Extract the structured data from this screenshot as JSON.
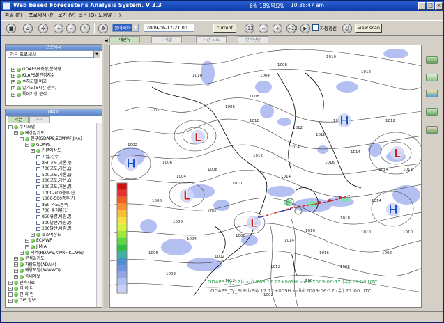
{
  "window": {
    "title": "Web based Forecaster's Analysis System. V 3.3",
    "date": "6월 18일",
    "weekday": "목요일",
    "time": "10:36:47 am",
    "controls": [
      "_",
      "□",
      "×"
    ]
  },
  "menu": [
    "파일 (F)",
    "프로세서 (P)",
    "보기 (V)",
    "옵션 (O)",
    "도움말 (H)"
  ],
  "toolbar": {
    "region_select": "동아시아",
    "datetime": "2009-06-17-21:00",
    "current_label": "current",
    "step_back12": "-12",
    "step_back": "−",
    "step_fwd": "+",
    "step_fwd12": "+12",
    "auto_label": "자동갱신",
    "view_scan_label": "view scan"
  },
  "left_top": {
    "title": "프로세서",
    "select": "기본 프로세서",
    "items": [
      "GDAPS예측장/분석장",
      "KLAPS불안정지수",
      "수치모델 비교",
      "일기도(6시간 간격)",
      "특이기상 분석"
    ]
  },
  "left_bottom": {
    "title": "데이터",
    "tabs": [
      "기본",
      "추가"
    ],
    "tree": [
      {
        "label": "수치모델",
        "indent": 0,
        "icon": "exp"
      },
      {
        "label": "예상일기도",
        "indent": 1,
        "icon": "exp"
      },
      {
        "label": "전구(GDAPS,ECMWF,JMA)",
        "indent": 2,
        "icon": "exp"
      },
      {
        "label": "GDAPS",
        "indent": 3,
        "icon": "exp"
      },
      {
        "label": "기본예상도",
        "indent": 4,
        "icon": "exp"
      },
      {
        "label": "기압,강수",
        "indent": 5,
        "icon": "cb"
      },
      {
        "label": "850고도,기온,풍",
        "indent": 5,
        "icon": "cb"
      },
      {
        "label": "700고도,기온,습",
        "indent": 5,
        "icon": "cb"
      },
      {
        "label": "500고도,기온,습",
        "indent": 5,
        "icon": "cb"
      },
      {
        "label": "300고도,기온,습",
        "indent": 5,
        "icon": "cb"
      },
      {
        "label": "200고도,기온,풍",
        "indent": 5,
        "icon": "cb"
      },
      {
        "label": "1000-700층후,습",
        "indent": 5,
        "icon": "cb"
      },
      {
        "label": "1000-500층후,기",
        "indent": 5,
        "icon": "cb"
      },
      {
        "label": "850 와도,풍속",
        "indent": 5,
        "icon": "cb"
      },
      {
        "label": "700 수직류(1)",
        "indent": 5,
        "icon": "cb"
      },
      {
        "label": "850유량,바람,풍",
        "indent": 5,
        "icon": "cb"
      },
      {
        "label": "300발산,바람,풍",
        "indent": 5,
        "icon": "cb"
      },
      {
        "label": "200발산,바람,풍",
        "indent": 5,
        "icon": "cb"
      },
      {
        "label": "보조예상도",
        "indent": 4,
        "icon": "exp"
      },
      {
        "label": "ECMWF",
        "indent": 3,
        "icon": "exp"
      },
      {
        "label": "J M A",
        "indent": 3,
        "icon": "exp"
      },
      {
        "label": "지역(RDAPS,KWRF,KLAPS)",
        "indent": 2,
        "icon": "exp"
      },
      {
        "label": "분석일기도",
        "indent": 1,
        "icon": "exp"
      },
      {
        "label": "파랑모델(ADAM)",
        "indent": 1,
        "icon": "exp"
      },
      {
        "label": "해양모델(ReWWD)",
        "indent": 1,
        "icon": "exp"
      },
      {
        "label": "동네예보",
        "indent": 1,
        "icon": "exp"
      },
      {
        "label": "관측자료",
        "indent": 0,
        "icon": "exp"
      },
      {
        "label": "레 이 더",
        "indent": 0,
        "icon": "exp"
      },
      {
        "label": "천 리 안",
        "indent": 0,
        "icon": "exp"
      },
      {
        "label": "GIS 정보",
        "indent": 0,
        "icon": "exp"
      }
    ]
  },
  "map": {
    "tabs": [
      "예만뷰",
      "시계열",
      "시간-고도",
      "연직단면"
    ],
    "pressure_labels": [
      "1010",
      "1002",
      "1006",
      "1008",
      "1004",
      "1008",
      "1010",
      "1012",
      "1002",
      "1006",
      "1004",
      "1008",
      "1010",
      "1012",
      "1014",
      "1016",
      "1018",
      "1014",
      "1012",
      "1006",
      "1010",
      "1008",
      "1004",
      "1002",
      "1006",
      "1008",
      "1012",
      "1014",
      "1010",
      "1016",
      "1018",
      "1014",
      "1012",
      "1010",
      "1008",
      "1006",
      "1004",
      "1002",
      "1010",
      "1014",
      "1012",
      "1016",
      "1014",
      "1010",
      "1008",
      "1012"
    ],
    "highs": [
      "H",
      "H",
      "H"
    ],
    "lows": [
      "L",
      "L",
      "L",
      "L"
    ],
    "caption1": "GDAPS_Ty_12(mm) IMG 17.12+009H valid 2009-06-17 (수) 21:00 UTC",
    "caption2": "GDAPS_Ty_SLP(hPa) 17.12+009H valid 2009-06-17 (수) 21:00 UTC"
  },
  "colors": {
    "title_bar": "#1a4fc0",
    "high": "#1d4fd0",
    "low": "#d21818",
    "precip": "#a8b4f0"
  }
}
